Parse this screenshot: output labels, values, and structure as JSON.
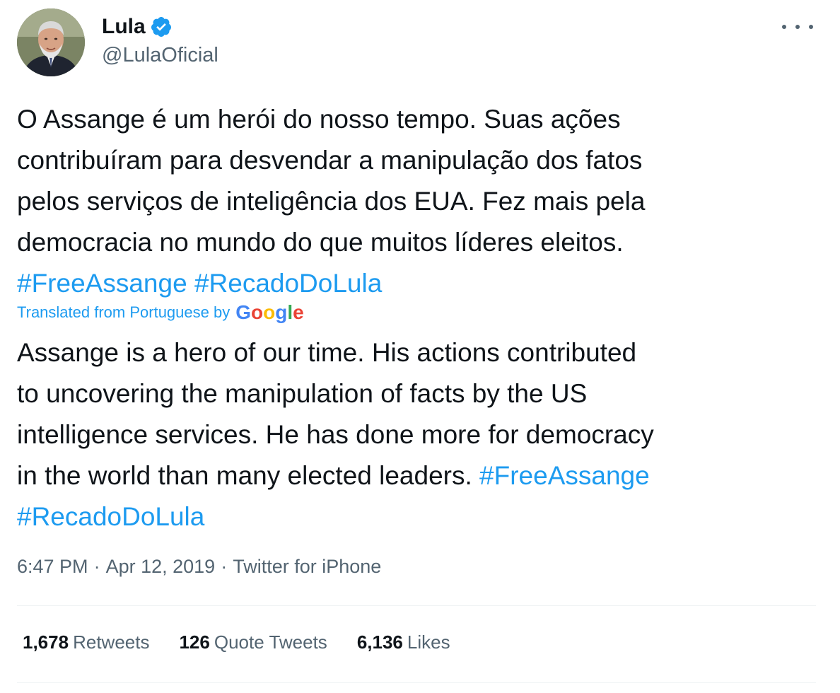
{
  "author": {
    "name": "Lula",
    "handle": "@LulaOficial",
    "verified": true,
    "avatar_icon": "profile-photo"
  },
  "tweet": {
    "original_lines": [
      "O Assange é um herói do nosso tempo. Suas ações",
      "contribuíram para desvendar a manipulação dos fatos",
      "pelos serviços de inteligência dos EUA. Fez mais pela",
      "democracia no mundo do que muitos líderes eleitos."
    ],
    "original_hashtags": [
      "#FreeAssange",
      "#RecadoDoLula"
    ],
    "translated_label": "Translated from Portuguese by",
    "translator_brand": "Google",
    "translated_lines": [
      "Assange is a hero of our time. His actions contributed",
      "to uncovering the manipulation of facts by the US",
      "intelligence services. He has done more for democracy",
      "in the world than many elected leaders."
    ],
    "translated_hashtags": [
      "#FreeAssange",
      "#RecadoDoLula"
    ],
    "time": "6:47 PM",
    "date": "Apr 12, 2019",
    "source": "Twitter for iPhone",
    "separator": "·"
  },
  "stats": {
    "retweets": {
      "count": "1,678",
      "label": "Retweets"
    },
    "quotes": {
      "count": "126",
      "label": "Quote Tweets"
    },
    "likes": {
      "count": "6,136",
      "label": "Likes"
    }
  },
  "colors": {
    "text": "#0f1419",
    "secondary": "#536471",
    "link": "#1d9bf0",
    "verified": "#1d9bf0"
  }
}
